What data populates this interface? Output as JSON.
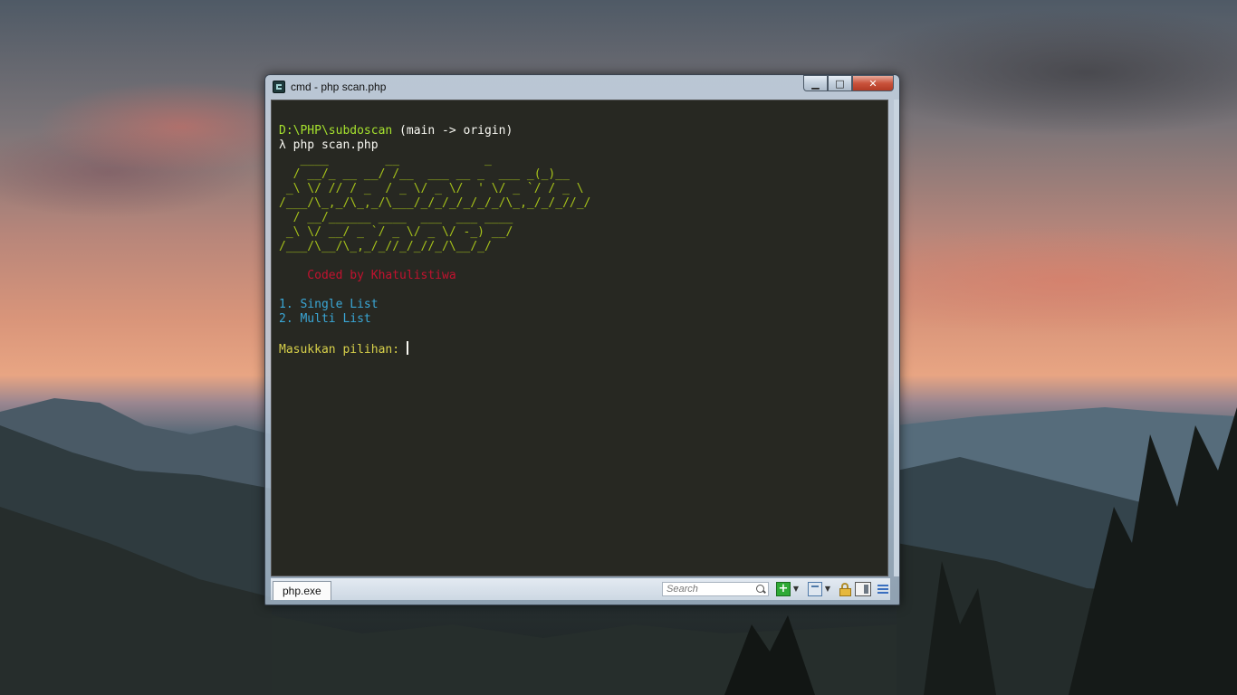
{
  "window": {
    "title": "cmd - php  scan.php",
    "controls": {
      "minimize": "▁",
      "maximize": "□",
      "close": "✕"
    }
  },
  "console": {
    "prompt_path": "D:\\PHP\\subdoscan",
    "prompt_branch": " (main -> origin)",
    "command": "λ php scan.php",
    "banner": [
      "   ____        __            _",
      "  / __/_ __ __/ /__  ___ __ _  ___ _(_)__",
      " _\\ \\/ // / _  / _ \\/ _ \\/  ' \\/ _ `/ / _ \\",
      "/___/\\_,_/\\_,_/\\___/_/_/_/_/_/_/\\_,_/_/_//_/",
      "  / __/______ ____  ___  ___ ____",
      " _\\ \\/ __/ _ `/ _ \\/ _ \\/ -_) __/",
      "/___/\\__/\\_,_/_//_/_//_/\\__/_/"
    ],
    "credit": "    Coded by Khatulistiwa",
    "menu": [
      "1. Single List",
      "2. Multi List"
    ],
    "input_prompt": "Masukkan pilihan: "
  },
  "statusbar": {
    "tab_label": "php.exe",
    "search_placeholder": "Search"
  },
  "icons": [
    "console-app-icon",
    "search-icon",
    "add-icon",
    "split-icon",
    "lock-icon",
    "view-icon",
    "menu-icon"
  ]
}
